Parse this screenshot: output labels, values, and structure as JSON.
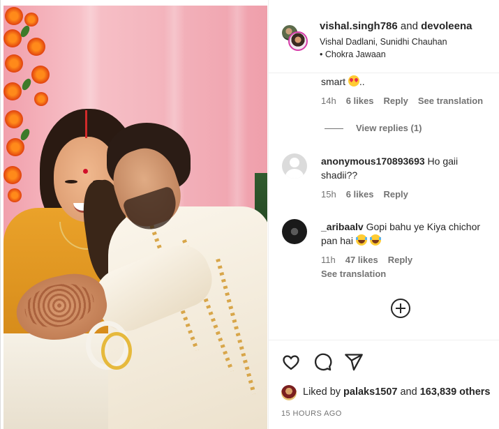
{
  "header": {
    "user1": "vishal.singh786",
    "conj": "and",
    "user2": "devoleena",
    "audio": "Vishal Dadlani, Sunidhi Chauhan • Chokra Jawaan"
  },
  "comments": [
    {
      "text_tail": "smart",
      "text_tail_suffix": "..",
      "emoji": "smiling-face-with-heart-eyes",
      "time": "14h",
      "likes": "6 likes",
      "reply": "Reply",
      "translate": "See translation",
      "view_replies": "View replies (1)"
    },
    {
      "username": "anonymous170893693",
      "text": "Ho gaii shadii??",
      "time": "15h",
      "likes": "6 likes",
      "reply": "Reply"
    },
    {
      "username": "_aribaalv",
      "text": "Gopi bahu ye Kiya chichor pan hai",
      "emoji": "face-with-tears-of-joy",
      "time": "11h",
      "likes": "47 likes",
      "reply": "Reply",
      "translate": "See translation"
    }
  ],
  "likes": {
    "prefix": "Liked by",
    "user": "palaks1507",
    "conj": "and",
    "others": "163,839 others"
  },
  "timestamp": "15 HOURS AGO"
}
